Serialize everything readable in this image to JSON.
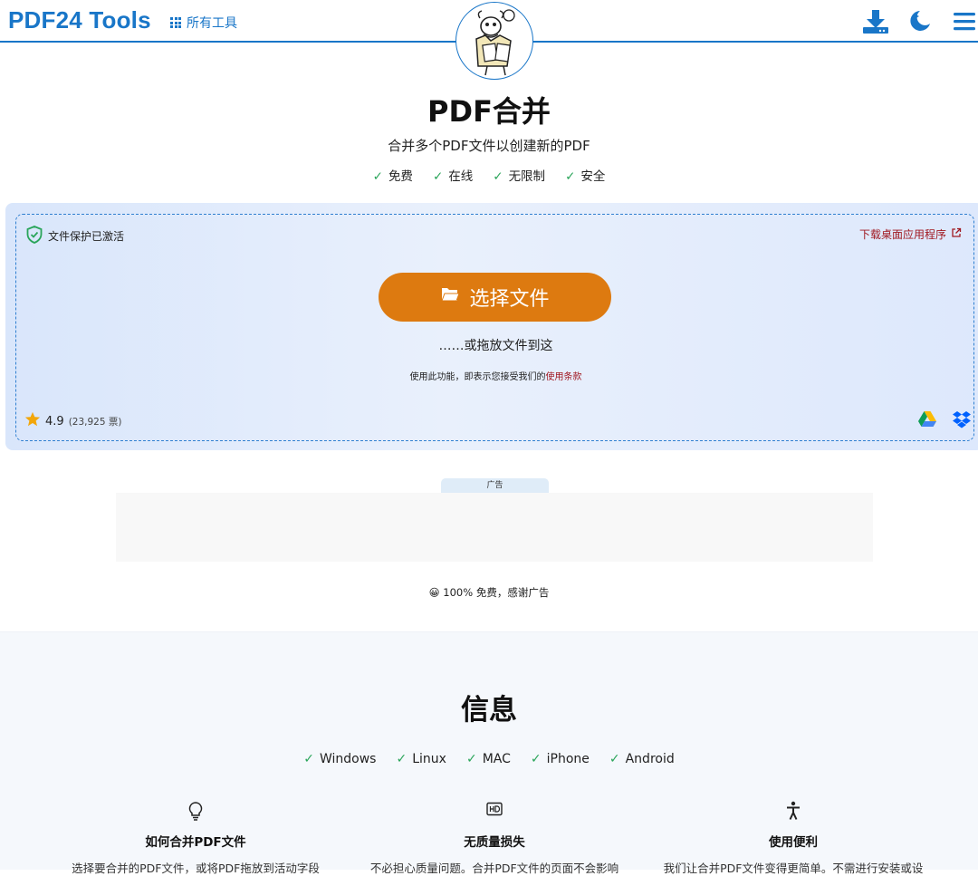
{
  "header": {
    "brand": "PDF24 Tools",
    "all_tools_label": "所有工具"
  },
  "hero": {
    "title": "PDF合并",
    "subtitle": "合并多个PDF文件以创建新的PDF",
    "features": [
      "免费",
      "在线",
      "无限制",
      "安全"
    ]
  },
  "dropzone": {
    "protection_label": "文件保护已激活",
    "desktop_link": "下载桌面应用程序",
    "choose_button": "选择文件",
    "drop_hint": "……或拖放文件到这",
    "terms_prefix": "使用此功能，即表示您接受我们的",
    "terms_link": "使用条款",
    "rating_value": "4.9",
    "rating_votes": "(23,925 票)"
  },
  "ad": {
    "label": "广告",
    "thanks": "😀 100% 免费，感谢广告"
  },
  "info": {
    "title": "信息",
    "platforms": [
      "Windows",
      "Linux",
      "MAC",
      "iPhone",
      "Android"
    ],
    "columns": [
      {
        "icon": "lightbulb-icon",
        "title": "如何合并PDF文件",
        "text": "选择要合并的PDF文件，或将PDF拖放到活动字段"
      },
      {
        "icon": "hd-icon",
        "title": "无质量损失",
        "text": "不必担心质量问题。合并PDF文件的页面不会影响"
      },
      {
        "icon": "accessibility-icon",
        "title": "使用便利",
        "text": "我们让合并PDF文件变得更简单。不需进行安装或设"
      }
    ]
  },
  "colors": {
    "brand_blue": "#1976c8",
    "button_orange": "#dd7a10",
    "check_green": "#2aa55a",
    "link_red": "#a01820"
  }
}
